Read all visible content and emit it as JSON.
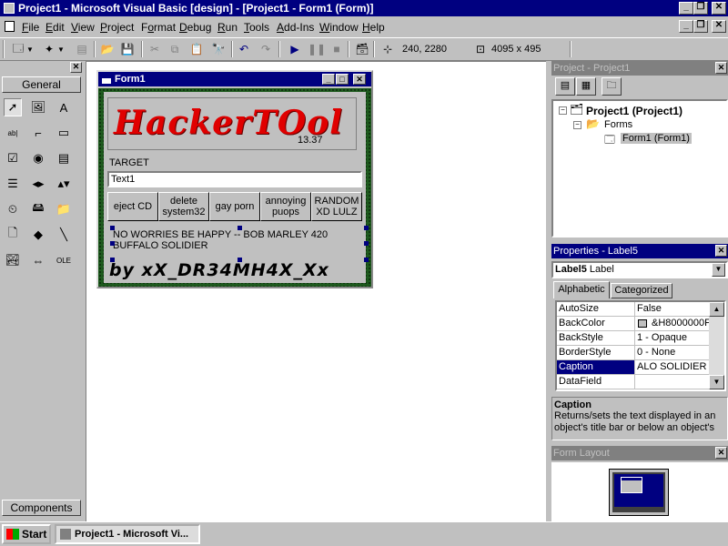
{
  "app": {
    "title": "Project1 - Microsoft Visual Basic [design] - [Project1 - Form1 (Form)]",
    "colors": {
      "titlebar": "#000080",
      "face": "#c0c0c0",
      "form_border": "#1e5a1e",
      "logo_red": "#e00000"
    }
  },
  "menu": {
    "items": [
      {
        "pre": "",
        "u": "F",
        "post": "ile"
      },
      {
        "pre": "",
        "u": "E",
        "post": "dit"
      },
      {
        "pre": "",
        "u": "V",
        "post": "iew"
      },
      {
        "pre": "",
        "u": "P",
        "post": "roject"
      },
      {
        "pre": "F",
        "u": "o",
        "post": "rmat"
      },
      {
        "pre": "",
        "u": "D",
        "post": "ebug"
      },
      {
        "pre": "",
        "u": "R",
        "post": "un"
      },
      {
        "pre": "",
        "u": "T",
        "post": "ools"
      },
      {
        "pre": "",
        "u": "A",
        "post": "dd-Ins"
      },
      {
        "pre": "",
        "u": "W",
        "post": "indow"
      },
      {
        "pre": "",
        "u": "H",
        "post": "elp"
      }
    ]
  },
  "toolbar": {
    "position": "240, 2280",
    "size": "4095 x 495"
  },
  "toolbox": {
    "tab_label": "General",
    "components_label": "Components"
  },
  "form": {
    "title": "Form1",
    "logo_text": "HackerTOol",
    "version": "13.37",
    "target_label": "TARGET",
    "target_value": "Text1",
    "buttons": [
      {
        "label": "eject CD"
      },
      {
        "label": "delete system32"
      },
      {
        "label": "gay porn"
      },
      {
        "label": "annoying puops"
      },
      {
        "label": "RANDOM XD LULZ"
      }
    ],
    "label5_caption": "NO WORRIES BE HAPPY -- BOB MARLEY 420 BUFFALO SOLIDIER",
    "byline": "by xX_DR34MH4X_Xx"
  },
  "project": {
    "title": "Project - Project1",
    "root": "Project1 (Project1)",
    "folder": "Forms",
    "item": "Form1 (Form1)"
  },
  "properties": {
    "title": "Properties - Label5",
    "object_name": "Label5",
    "object_type": "Label",
    "tabs": [
      "Alphabetic",
      "Categorized"
    ],
    "rows": [
      {
        "name": "AutoSize",
        "value": "False"
      },
      {
        "name": "BackColor",
        "value": "&H8000000F"
      },
      {
        "name": "BackStyle",
        "value": "1 - Opaque"
      },
      {
        "name": "BorderStyle",
        "value": "0 - None"
      },
      {
        "name": "Caption",
        "value": "ALO SOLIDIER"
      },
      {
        "name": "DataField",
        "value": ""
      }
    ],
    "desc_title": "Caption",
    "desc_text": "Returns/sets the text displayed in an object's title bar or below an object's"
  },
  "form_layout": {
    "title": "Form Layout"
  },
  "taskbar": {
    "start": "Start",
    "task": "Project1 - Microsoft Vi..."
  }
}
